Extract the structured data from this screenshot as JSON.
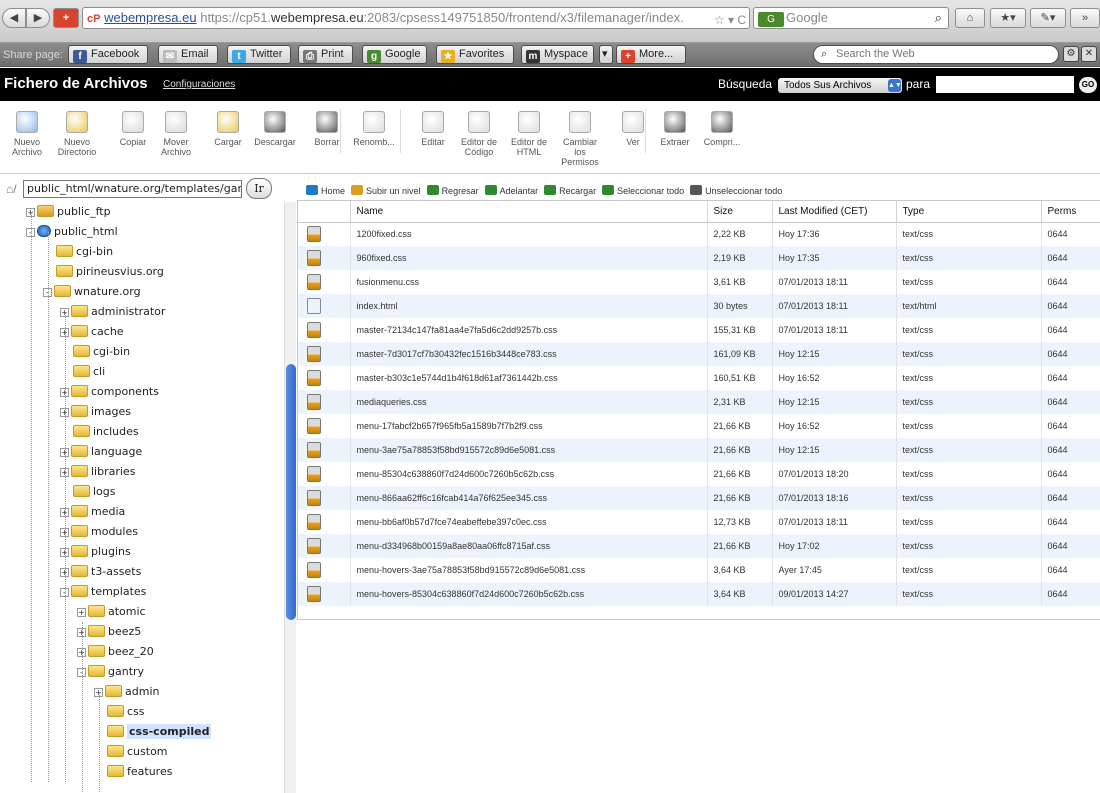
{
  "browser": {
    "url_domain_prefix": "webempresa.eu",
    "url_text_pre": "https://cp51.",
    "url_text_dom": "webempresa.eu",
    "url_text_post": ":2083/cpsess149751850/frontend/x3/filemanager/index.",
    "search_engine": "Google",
    "site_badge": "cP"
  },
  "sharebar": {
    "label": "Share page:",
    "buttons": [
      "Facebook",
      "Email",
      "Twitter",
      "Print",
      "Google",
      "Favorites",
      "Myspace",
      "More..."
    ],
    "search_placeholder": "Search the Web"
  },
  "header": {
    "title": "Fichero de Archivos",
    "config_link": "Configuraciones",
    "search_label": "Búsqueda",
    "search_scope": "Todos Sus Archivos",
    "for_label": "para",
    "go": "GO"
  },
  "toolbar": [
    {
      "label": "Nuevo\nArchivo",
      "icon": "new-file-icon",
      "color": "#8fb8e8"
    },
    {
      "label": "Nuevo\nDirectorio",
      "icon": "new-folder-icon",
      "color": "#e8c850"
    },
    {
      "label": "Copiar",
      "icon": "copy-icon",
      "color": "#d8d8d8"
    },
    {
      "label": "Mover\nArchivo",
      "icon": "move-file-icon",
      "color": "#d8d8d8"
    },
    {
      "label": "Cargar",
      "icon": "upload-icon",
      "color": "#e8c850"
    },
    {
      "label": "Descargar",
      "icon": "download-icon",
      "color": "#555555"
    },
    {
      "label": "Borrar",
      "icon": "delete-icon",
      "color": "#555555"
    },
    {
      "label": "Renomb...",
      "icon": "rename-icon",
      "color": "#dddddd"
    },
    {
      "label": "Editar",
      "icon": "edit-icon",
      "color": "#dddddd"
    },
    {
      "label": "Editor de\nCódigo",
      "icon": "code-editor-icon",
      "color": "#dddddd"
    },
    {
      "label": "Editor de\nHTML",
      "icon": "html-editor-icon",
      "color": "#dddddd"
    },
    {
      "label": "Cambiar\nlos\nPermisos",
      "icon": "permissions-icon",
      "color": "#dddddd"
    },
    {
      "label": "Ver",
      "icon": "view-icon",
      "color": "#dddddd"
    },
    {
      "label": "Extraer",
      "icon": "extract-icon",
      "color": "#555555"
    },
    {
      "label": "Compri...",
      "icon": "compress-icon",
      "color": "#555555"
    }
  ],
  "tree": {
    "path": "public_html/wnature.org/templates/gantr",
    "go": "Ir",
    "nodes": [
      {
        "label": "public_ftp",
        "depth": 1,
        "exp": "+"
      },
      {
        "label": "public_html",
        "depth": 1,
        "exp": "-"
      },
      {
        "label": "cgi-bin",
        "depth": 2,
        "exp": ""
      },
      {
        "label": "pirineusvius.org",
        "depth": 2,
        "exp": ""
      },
      {
        "label": "wnature.org",
        "depth": 2,
        "exp": "-"
      },
      {
        "label": "administrator",
        "depth": 3,
        "exp": "+"
      },
      {
        "label": "cache",
        "depth": 3,
        "exp": "+"
      },
      {
        "label": "cgi-bin",
        "depth": 3,
        "exp": ""
      },
      {
        "label": "cli",
        "depth": 3,
        "exp": ""
      },
      {
        "label": "components",
        "depth": 3,
        "exp": "+"
      },
      {
        "label": "images",
        "depth": 3,
        "exp": "+"
      },
      {
        "label": "includes",
        "depth": 3,
        "exp": ""
      },
      {
        "label": "language",
        "depth": 3,
        "exp": "+"
      },
      {
        "label": "libraries",
        "depth": 3,
        "exp": "+"
      },
      {
        "label": "logs",
        "depth": 3,
        "exp": ""
      },
      {
        "label": "media",
        "depth": 3,
        "exp": "+"
      },
      {
        "label": "modules",
        "depth": 3,
        "exp": "+"
      },
      {
        "label": "plugins",
        "depth": 3,
        "exp": "+"
      },
      {
        "label": "t3-assets",
        "depth": 3,
        "exp": "+"
      },
      {
        "label": "templates",
        "depth": 3,
        "exp": "-"
      },
      {
        "label": "atomic",
        "depth": 4,
        "exp": "+"
      },
      {
        "label": "beez5",
        "depth": 4,
        "exp": "+"
      },
      {
        "label": "beez_20",
        "depth": 4,
        "exp": "+"
      },
      {
        "label": "gantry",
        "depth": 4,
        "exp": "-"
      },
      {
        "label": "admin",
        "depth": 5,
        "exp": "+"
      },
      {
        "label": "css",
        "depth": 5,
        "exp": ""
      },
      {
        "label": "css-compiled",
        "depth": 5,
        "exp": "",
        "selected": true
      },
      {
        "label": "custom",
        "depth": 5,
        "exp": ""
      },
      {
        "label": "features",
        "depth": 5,
        "exp": ""
      }
    ]
  },
  "actions": [
    "Home",
    "Subir un nivel",
    "Regresar",
    "Adelantar",
    "Recargar",
    "Seleccionar todo",
    "Unseleccionar todo"
  ],
  "columns": [
    "Name",
    "Size",
    "Last Modified (CET)",
    "Type",
    "Perms"
  ],
  "files": [
    {
      "type_icon": "css",
      "name": "1200fixed.css",
      "size": "2,22 KB",
      "modified": "Hoy 17:36",
      "type": "text/css",
      "perms": "0644"
    },
    {
      "type_icon": "css",
      "name": "960fixed.css",
      "size": "2,19 KB",
      "modified": "Hoy 17:35",
      "type": "text/css",
      "perms": "0644"
    },
    {
      "type_icon": "css",
      "name": "fusionmenu.css",
      "size": "3,61 KB",
      "modified": "07/01/2013 18:11",
      "type": "text/css",
      "perms": "0644"
    },
    {
      "type_icon": "html",
      "name": "index.html",
      "size": "30 bytes",
      "modified": "07/01/2013 18:11",
      "type": "text/html",
      "perms": "0644"
    },
    {
      "type_icon": "css",
      "name": "master-72134c147fa81aa4e7fa5d6c2dd9257b.css",
      "size": "155,31 KB",
      "modified": "07/01/2013 18:11",
      "type": "text/css",
      "perms": "0644"
    },
    {
      "type_icon": "css",
      "name": "master-7d3017cf7b30432fec1516b3448ce783.css",
      "size": "161,09 KB",
      "modified": "Hoy 12:15",
      "type": "text/css",
      "perms": "0644"
    },
    {
      "type_icon": "css",
      "name": "master-b303c1e5744d1b4f618d61af7361442b.css",
      "size": "160,51 KB",
      "modified": "Hoy 16:52",
      "type": "text/css",
      "perms": "0644"
    },
    {
      "type_icon": "css",
      "name": "mediaqueries.css",
      "size": "2,31 KB",
      "modified": "Hoy 12:15",
      "type": "text/css",
      "perms": "0644"
    },
    {
      "type_icon": "css",
      "name": "menu-17fabcf2b657f965fb5a1589b7f7b2f9.css",
      "size": "21,66 KB",
      "modified": "Hoy 16:52",
      "type": "text/css",
      "perms": "0644"
    },
    {
      "type_icon": "css",
      "name": "menu-3ae75a78853f58bd915572c89d6e5081.css",
      "size": "21,66 KB",
      "modified": "Hoy 12:15",
      "type": "text/css",
      "perms": "0644"
    },
    {
      "type_icon": "css",
      "name": "menu-85304c638860f7d24d600c7260b5c62b.css",
      "size": "21,66 KB",
      "modified": "07/01/2013 18:20",
      "type": "text/css",
      "perms": "0644"
    },
    {
      "type_icon": "css",
      "name": "menu-866aa62ff6c16fcab414a76f625ee345.css",
      "size": "21,66 KB",
      "modified": "07/01/2013 18:16",
      "type": "text/css",
      "perms": "0644"
    },
    {
      "type_icon": "css",
      "name": "menu-bb6af0b57d7fce74eabeffebe397c0ec.css",
      "size": "12,73 KB",
      "modified": "07/01/2013 18:11",
      "type": "text/css",
      "perms": "0644"
    },
    {
      "type_icon": "css",
      "name": "menu-d334968b00159a8ae80aa06ffc8715af.css",
      "size": "21,66 KB",
      "modified": "Hoy 17:02",
      "type": "text/css",
      "perms": "0644"
    },
    {
      "type_icon": "css",
      "name": "menu-hovers-3ae75a78853f58bd915572c89d6e5081.css",
      "size": "3,64 KB",
      "modified": "Ayer 17:45",
      "type": "text/css",
      "perms": "0644"
    },
    {
      "type_icon": "css",
      "name": "menu-hovers-85304c638860f7d24d600c7260b5c62b.css",
      "size": "3,64 KB",
      "modified": "09/01/2013 14:27",
      "type": "text/css",
      "perms": "0644"
    }
  ]
}
